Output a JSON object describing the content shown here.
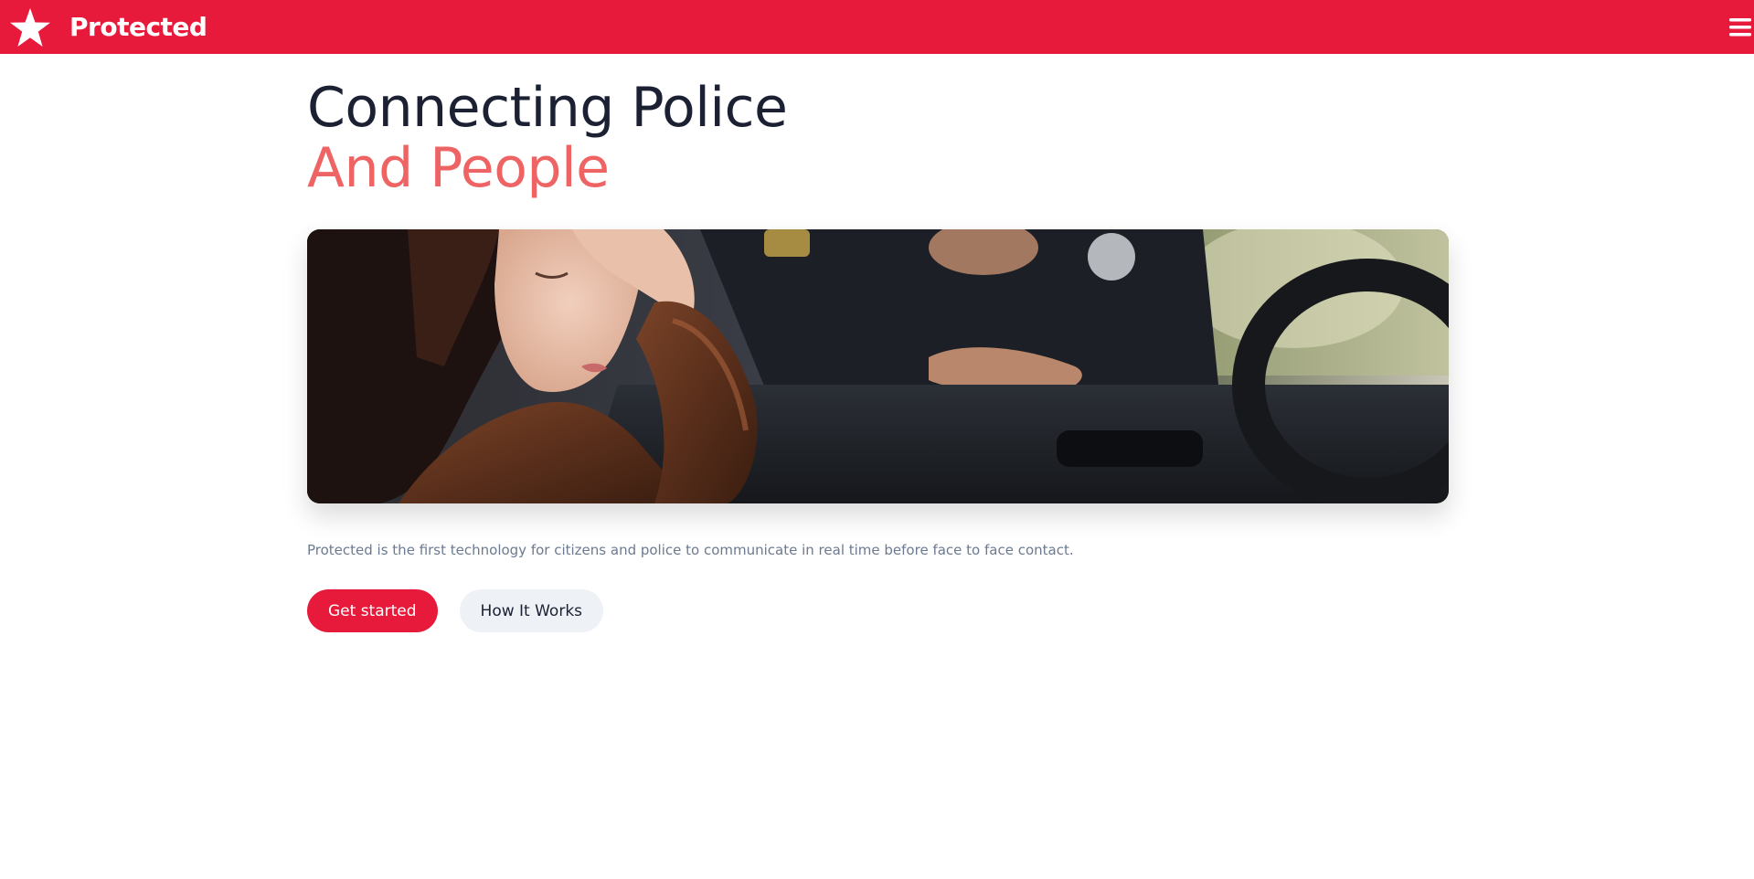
{
  "header": {
    "brand_name": "Protected",
    "logo_icon": "star-icon",
    "menu_icon": "hamburger-menu-icon"
  },
  "hero": {
    "title_line1": "Connecting Police",
    "title_line2": "And People",
    "image_alt": "Woman in car with hand on forehead while a police officer talks to her through the window",
    "description": "Protected is the first technology for citizens and police to communicate in real time before face to face contact.",
    "primary_button": "Get started",
    "secondary_button": "How It Works"
  },
  "colors": {
    "brand": "#e81a3b",
    "title_dark": "#1b2133",
    "title_accent": "#ee6464",
    "muted_text": "#6b7a90",
    "secondary_button_bg": "#eef1f5"
  }
}
